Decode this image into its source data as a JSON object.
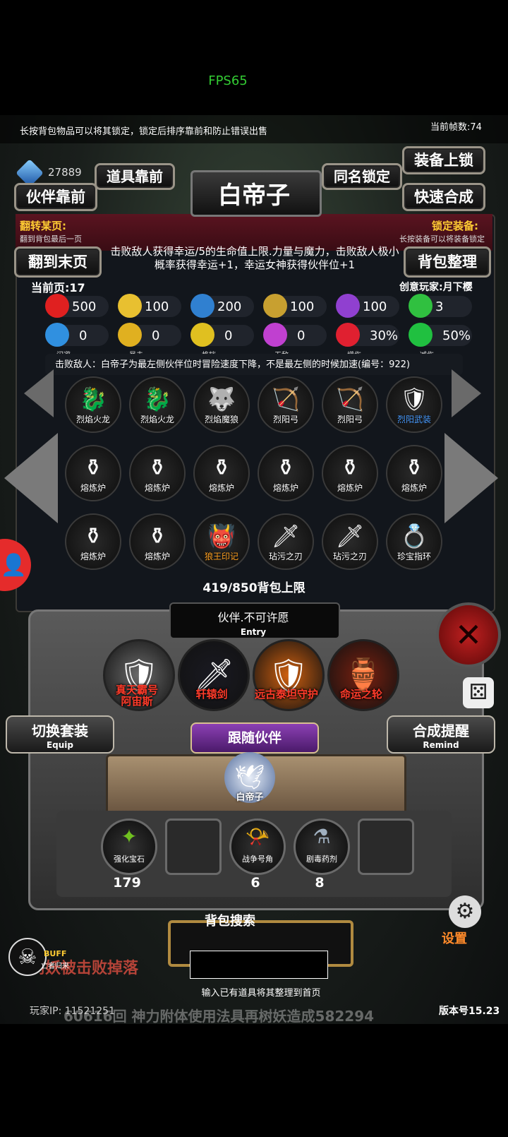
{
  "status": {
    "fps": "FPS65"
  },
  "header": {
    "tip": "长按背包物品可以将其锁定，锁定后排序靠前和防止错误出售",
    "frame_count": "当前帧数:74",
    "gem_value": "27889",
    "partner_first_label": "伙伴靠前",
    "item_first_label": "道具靠前",
    "title": "白帝子",
    "same_name_lock_label": "同名锁定",
    "equip_lock_label": "装备上锁",
    "quick_merge_label": "快速合成",
    "flip_page_title": "翻转某页:",
    "flip_page_sub": "翻到背包最后一页",
    "lock_equip_title": "锁定装备:",
    "lock_equip_sub": "长按装备可以将装备锁定",
    "last_page_label": "翻到末页",
    "organize_label": "背包整理",
    "description": "击败敌人获得幸运/5的生命值上限.力量与魔力，击败敌人极小概率获得幸运+1，幸运女神获得伙伴位+1",
    "current_page": "当前页:17",
    "creator": "创意玩家:月下樱"
  },
  "stats_row1": [
    {
      "icon": "heart-icon",
      "value": "500",
      "color": "#e02020"
    },
    {
      "icon": "strength-icon",
      "value": "100",
      "color": "#e8c030"
    },
    {
      "icon": "magic-icon",
      "value": "200",
      "color": "#3080d0"
    },
    {
      "icon": "sword-icon",
      "value": "100",
      "color": "#c8a030"
    },
    {
      "icon": "lightning-icon",
      "value": "100",
      "color": "#9040d0"
    },
    {
      "icon": "clover-icon",
      "value": "3",
      "color": "#30c040"
    }
  ],
  "stats_row2": [
    {
      "icon": "dodge-icon",
      "value": "0",
      "name": "闪避",
      "color": "#3090e0"
    },
    {
      "icon": "crit-icon",
      "value": "0",
      "name": "暴击",
      "color": "#e0b020"
    },
    {
      "icon": "block-icon",
      "value": "0",
      "name": "格挡",
      "color": "#e0c020"
    },
    {
      "icon": "invincible-icon",
      "value": "0",
      "name": "无敌",
      "color": "#c040d0"
    },
    {
      "icon": "damage-up-icon",
      "value": "30%",
      "name": "增伤",
      "color": "#e02030"
    },
    {
      "icon": "damage-down-icon",
      "value": "50%",
      "name": "减伤",
      "color": "#20c040"
    }
  ],
  "effect_text": "击败敌人：白帝子为最左侧伙伴位时冒险速度下降，不是最左侧的时候加速(编号：922)",
  "bag_items": [
    {
      "name": "烈焰火龙",
      "icon": "red-dragon-icon",
      "glyph": "🐉",
      "name_color": "#ffffff"
    },
    {
      "name": "烈焰火龙",
      "icon": "red-dragon-icon",
      "glyph": "🐉",
      "name_color": "#ffffff"
    },
    {
      "name": "烈焰魔狼",
      "icon": "flame-wolf-icon",
      "glyph": "🐺",
      "name_color": "#ffffff"
    },
    {
      "name": "烈阳弓",
      "icon": "bow-icon",
      "glyph": "🏹",
      "name_color": "#ffffff"
    },
    {
      "name": "烈阳弓",
      "icon": "bow-icon",
      "glyph": "🏹",
      "name_color": "#ffffff"
    },
    {
      "name": "烈阳武装",
      "icon": "sun-armor-icon",
      "glyph": "🛡",
      "name_color": "#4a9cff"
    },
    {
      "name": "熔炼炉",
      "icon": "furnace-icon",
      "glyph": "⚱",
      "name_color": "#ffffff"
    },
    {
      "name": "熔炼炉",
      "icon": "furnace-icon",
      "glyph": "⚱",
      "name_color": "#ffffff"
    },
    {
      "name": "熔炼炉",
      "icon": "furnace-icon",
      "glyph": "⚱",
      "name_color": "#ffffff"
    },
    {
      "name": "熔炼炉",
      "icon": "furnace-icon",
      "glyph": "⚱",
      "name_color": "#ffffff"
    },
    {
      "name": "熔炼炉",
      "icon": "furnace-icon",
      "glyph": "⚱",
      "name_color": "#ffffff"
    },
    {
      "name": "熔炼炉",
      "icon": "furnace-icon",
      "glyph": "⚱",
      "name_color": "#ffffff"
    },
    {
      "name": "熔炼炉",
      "icon": "furnace-icon",
      "glyph": "⚱",
      "name_color": "#ffffff"
    },
    {
      "name": "熔炼炉",
      "icon": "furnace-icon",
      "glyph": "⚱",
      "name_color": "#ffffff"
    },
    {
      "name": "狼王印记",
      "icon": "wolf-king-mark-icon",
      "glyph": "👹",
      "name_color": "#ffa020"
    },
    {
      "name": "玷污之刃",
      "icon": "tainted-blade-icon",
      "glyph": "🗡",
      "name_color": "#ffffff"
    },
    {
      "name": "玷污之刃",
      "icon": "tainted-blade-icon",
      "glyph": "🗡",
      "name_color": "#ffffff"
    },
    {
      "name": "珍宝指环",
      "icon": "treasure-ring-icon",
      "glyph": "💍",
      "name_color": "#ffffff"
    }
  ],
  "bag_limit": "419/850背包上限",
  "entry": {
    "title": "伙伴.不可许愿",
    "sub": "Entry"
  },
  "heroes": [
    {
      "name": "真天霸号\n阿宙斯",
      "icon": "zeus-armor-icon",
      "glyph": "🛡",
      "bg": "#6b6b6b"
    },
    {
      "name": "轩辕剑",
      "icon": "xuanyuan-sword-icon",
      "glyph": "🗡",
      "bg": "#1a1a22"
    },
    {
      "name": "远古泰坦守护",
      "icon": "titan-guard-icon",
      "glyph": "🛡",
      "bg": "#d06010"
    },
    {
      "name": "命运之轮",
      "icon": "wheel-of-fate-icon",
      "glyph": "🏺",
      "bg": "#7a2010"
    }
  ],
  "switch_set": {
    "label": "切换套装",
    "sub": "Equip"
  },
  "merge_remind": {
    "label": "合成提醒",
    "sub": "Remind"
  },
  "follow_partner": {
    "label": "跟随伙伴",
    "name": "白帝子"
  },
  "consumables": [
    {
      "name": "强化宝石",
      "count": "179",
      "icon": "enhance-gem-icon",
      "glyph": "✦",
      "color": "#70c020"
    },
    {
      "name": "",
      "count": "",
      "icon": "empty-slot-icon",
      "glyph": "",
      "color": ""
    },
    {
      "name": "战争号角",
      "count": "6",
      "icon": "war-horn-icon",
      "glyph": "📯",
      "color": "#c0a0e0"
    },
    {
      "name": "剧毒药剂",
      "count": "8",
      "icon": "poison-potion-icon",
      "glyph": "⚗",
      "color": "#a0b0c0"
    },
    {
      "name": "",
      "count": "",
      "icon": "empty-slot-icon",
      "glyph": "",
      "color": ""
    }
  ],
  "search": {
    "label": "背包搜索",
    "value": "",
    "hint": "输入已有道具将其整理到首页"
  },
  "footer": {
    "ticker1": "树妖被击败掉落",
    "ticker2": "60616回 神力附体使用法具再树妖造成582294",
    "player_ip": "玩家IP:   11521251",
    "version": "版本号15.23",
    "settings_label": "设置",
    "buff_label": "BUFF",
    "buff_name": "亡者归来"
  }
}
